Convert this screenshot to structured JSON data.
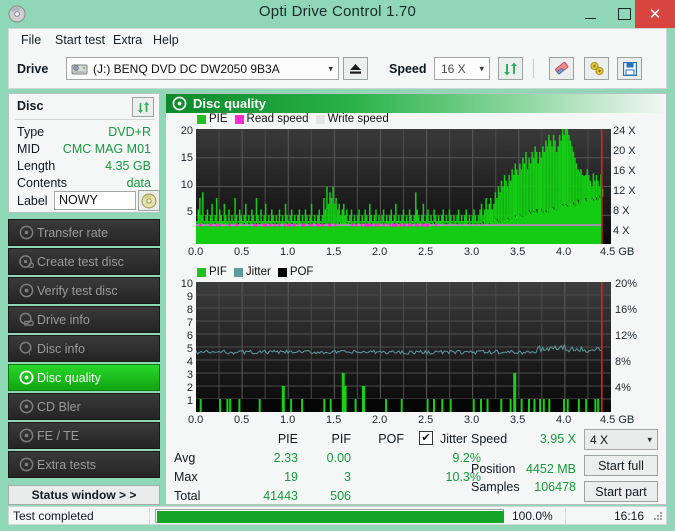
{
  "window": {
    "title": "Opti Drive Control 1.70",
    "app_icon": "disc-icon",
    "minimize": "–",
    "maximize": "□",
    "close": "✕"
  },
  "menu": {
    "items": [
      {
        "label": "File"
      },
      {
        "label": "Start test"
      },
      {
        "label": "Extra"
      },
      {
        "label": "Help"
      }
    ]
  },
  "toolbar": {
    "drive_label": "Drive",
    "drive_value": "(J:)   BENQ DVD DC DW2050 9B3A",
    "eject_icon": "eject-icon",
    "speed_label": "Speed",
    "speed_value": "16 X",
    "refresh_icon": "refresh-icon",
    "eraser_icon": "eraser-icon",
    "tools_icon": "tools-icon",
    "save_icon": "save-icon"
  },
  "disc_panel": {
    "title": "Disc",
    "refresh_icon": "refresh-icon",
    "rows": [
      {
        "label": "Type",
        "value": "DVD+R"
      },
      {
        "label": "MID",
        "value": "CMC MAG M01"
      },
      {
        "label": "Length",
        "value": "4.35 GB"
      },
      {
        "label": "Contents",
        "value": "data"
      }
    ],
    "label_caption": "Label",
    "label_value": "NOWY",
    "disc_icon": "cd-disc-icon"
  },
  "sidebar": {
    "items": [
      {
        "label": "Transfer rate",
        "icon": "disc-icon",
        "active": false
      },
      {
        "label": "Create test disc",
        "icon": "disc-write-icon",
        "active": false
      },
      {
        "label": "Verify test disc",
        "icon": "disc-check-icon",
        "active": false
      },
      {
        "label": "Drive info",
        "icon": "drive-icon",
        "active": false
      },
      {
        "label": "Disc info",
        "icon": "disc-info-icon",
        "active": false
      },
      {
        "label": "Disc quality",
        "icon": "disc-quality-icon",
        "active": true
      },
      {
        "label": "CD Bler",
        "icon": "disc-icon",
        "active": false
      },
      {
        "label": "FE / TE",
        "icon": "disc-icon",
        "active": false
      },
      {
        "label": "Extra tests",
        "icon": "disc-icon",
        "active": false
      }
    ],
    "status_window_button": "Status window > >"
  },
  "main": {
    "header_title": "Disc quality",
    "header_icon": "disc-quality-icon"
  },
  "chart_data": [
    {
      "type": "bar",
      "title": "PIE",
      "xlabel": "GB",
      "ylabel": "PIE",
      "legend": [
        {
          "label": "PIE",
          "color": "#1fc21f"
        },
        {
          "label": "Read speed",
          "color": "#ff2ad4"
        },
        {
          "label": "Write speed",
          "color": "#e4e4e4"
        }
      ],
      "legend_position": "top-left",
      "grid": true,
      "xlim": [
        0.0,
        4.5
      ],
      "ylim": [
        0,
        20
      ],
      "xticks": [
        "0.0",
        "0.5",
        "1.0",
        "1.5",
        "2.0",
        "2.5",
        "3.0",
        "3.5",
        "4.0",
        "4.5 GB"
      ],
      "yticks": [
        "20",
        "15",
        "10",
        "5"
      ],
      "y2lim": [
        0,
        24
      ],
      "y2ticks": [
        "24 X",
        "20 X",
        "16 X",
        "12 X",
        "8 X",
        "4 X"
      ],
      "read_speed_line": 3.95,
      "end_marker_gb": 4.4,
      "values": [
        4,
        6,
        8,
        5,
        9,
        4,
        5,
        6,
        4,
        5,
        7,
        4,
        5,
        8,
        4,
        6,
        5,
        4,
        7,
        5,
        4,
        6,
        4,
        5,
        4,
        8,
        5,
        4,
        6,
        5,
        4,
        5,
        7,
        4,
        5,
        4,
        6,
        5,
        4,
        8,
        5,
        4,
        6,
        4,
        5,
        7,
        4,
        5,
        4,
        6,
        5,
        4,
        5,
        4,
        6,
        4,
        5,
        4,
        7,
        5,
        4,
        5,
        6,
        4,
        5,
        4,
        5,
        6,
        4,
        5,
        4,
        6,
        5,
        4,
        5,
        7,
        4,
        5,
        4,
        5,
        6,
        4,
        5,
        8,
        6,
        10,
        7,
        9,
        8,
        10,
        7,
        8,
        6,
        7,
        5,
        6,
        7,
        5,
        6,
        4,
        5,
        6,
        4,
        5,
        4,
        5,
        6,
        4,
        5,
        4,
        6,
        5,
        4,
        7,
        5,
        4,
        5,
        6,
        4,
        5,
        4,
        5,
        6,
        4,
        5,
        4,
        5,
        6,
        4,
        5,
        7,
        4,
        5,
        4,
        5,
        6,
        4,
        5,
        4,
        6,
        5,
        4,
        5,
        9,
        6,
        5,
        4,
        5,
        7,
        4,
        5,
        6,
        4,
        5,
        4,
        6,
        5,
        4,
        5,
        4,
        5,
        6,
        4,
        5,
        4,
        6,
        5,
        4,
        5,
        4,
        5,
        6,
        4,
        5,
        4,
        5,
        6,
        4,
        5,
        4,
        5,
        6,
        5,
        4,
        5,
        6,
        7,
        5,
        6,
        8,
        6,
        7,
        8,
        6,
        7,
        9,
        8,
        10,
        9,
        11,
        10,
        12,
        11,
        10,
        12,
        11,
        13,
        12,
        14,
        13,
        12,
        14,
        13,
        15,
        14,
        16,
        13,
        15,
        14,
        16,
        15,
        17,
        16,
        14,
        16,
        15,
        17,
        16,
        18,
        17,
        19,
        18,
        17,
        19,
        18,
        16,
        17,
        19,
        18,
        20,
        19,
        21,
        20,
        19,
        18,
        17,
        16,
        15,
        14,
        13,
        12,
        13,
        12,
        11,
        12,
        13,
        12,
        11,
        10,
        11,
        10,
        12,
        11,
        10,
        9,
        8
      ]
    },
    {
      "type": "bar",
      "title": "PIF",
      "xlabel": "GB",
      "ylabel": "PIF",
      "legend": [
        {
          "label": "PIF",
          "color": "#1fc21f"
        },
        {
          "label": "Jitter",
          "color": "#5d9aa0"
        },
        {
          "label": "POF",
          "color": "#000000"
        }
      ],
      "legend_position": "top-left",
      "grid": true,
      "xlim": [
        0.0,
        4.5
      ],
      "ylim": [
        0,
        10
      ],
      "xticks": [
        "0.0",
        "0.5",
        "1.0",
        "1.5",
        "2.0",
        "2.5",
        "3.0",
        "3.5",
        "4.0",
        "4.5 GB"
      ],
      "yticks": [
        "10",
        "9",
        "8",
        "7",
        "6",
        "5",
        "4",
        "3",
        "2",
        "1"
      ],
      "y2lim": [
        0,
        20
      ],
      "y2ticks": [
        "20%",
        "16%",
        "12%",
        "8%",
        "4%"
      ],
      "jitter_avg_pct": 9.2,
      "end_marker_gb": 4.4,
      "pif_spikes": [
        {
          "x": 0.04,
          "h": 1
        },
        {
          "x": 0.25,
          "h": 1
        },
        {
          "x": 0.33,
          "h": 1
        },
        {
          "x": 0.36,
          "h": 1
        },
        {
          "x": 0.46,
          "h": 1
        },
        {
          "x": 0.68,
          "h": 1
        },
        {
          "x": 0.93,
          "h": 2
        },
        {
          "x": 1.02,
          "h": 1
        },
        {
          "x": 1.14,
          "h": 1
        },
        {
          "x": 1.38,
          "h": 1
        },
        {
          "x": 1.45,
          "h": 1
        },
        {
          "x": 1.58,
          "h": 3
        },
        {
          "x": 1.6,
          "h": 2
        },
        {
          "x": 1.72,
          "h": 1
        },
        {
          "x": 1.8,
          "h": 2
        },
        {
          "x": 2.05,
          "h": 1
        },
        {
          "x": 2.22,
          "h": 1
        },
        {
          "x": 2.5,
          "h": 1
        },
        {
          "x": 2.57,
          "h": 1
        },
        {
          "x": 2.66,
          "h": 1
        },
        {
          "x": 2.75,
          "h": 1
        },
        {
          "x": 3.0,
          "h": 1
        },
        {
          "x": 3.08,
          "h": 1
        },
        {
          "x": 3.15,
          "h": 1
        },
        {
          "x": 3.3,
          "h": 1
        },
        {
          "x": 3.4,
          "h": 1
        },
        {
          "x": 3.44,
          "h": 3
        },
        {
          "x": 3.52,
          "h": 1
        },
        {
          "x": 3.6,
          "h": 1
        },
        {
          "x": 3.66,
          "h": 1
        },
        {
          "x": 3.72,
          "h": 1
        },
        {
          "x": 3.76,
          "h": 1
        },
        {
          "x": 3.82,
          "h": 1
        },
        {
          "x": 3.98,
          "h": 1
        },
        {
          "x": 4.02,
          "h": 1
        },
        {
          "x": 4.14,
          "h": 1
        },
        {
          "x": 4.22,
          "h": 1
        },
        {
          "x": 4.32,
          "h": 1
        },
        {
          "x": 4.35,
          "h": 1
        }
      ]
    }
  ],
  "stats": {
    "columns": [
      "PIE",
      "PIF",
      "POF"
    ],
    "jitter_label": "Jitter",
    "jitter_checked": true,
    "jitter_check_glyph": "✔",
    "rows": [
      {
        "label": "Avg",
        "pie": "2.33",
        "pif": "0.00",
        "pof": "",
        "jitter": "9.2%"
      },
      {
        "label": "Max",
        "pie": "19",
        "pif": "3",
        "pof": "",
        "jitter": "10.3%"
      },
      {
        "label": "Total",
        "pie": "41443",
        "pif": "506",
        "pof": "",
        "jitter": ""
      }
    ]
  },
  "readout": {
    "speed_label": "Speed",
    "speed_value": "3.95 X",
    "position_label": "Position",
    "position_value": "4452 MB",
    "samples_label": "Samples",
    "samples_value": "106478",
    "test_speed_select": "4 X",
    "start_full_button": "Start full",
    "start_part_button": "Start part"
  },
  "statusbar": {
    "message": "Test completed",
    "progress_percent": "100.0%",
    "progress_value": 100,
    "time": "16:16"
  },
  "colors": {
    "accent_green": "#1fc21f",
    "title_bg": "#8fd7b6",
    "close_red": "#d8453f",
    "value_green": "#149a3c",
    "jitter_teal": "#5d9aa0",
    "read_speed_magenta": "#ff2ad4",
    "marker_red": "#e02020"
  }
}
